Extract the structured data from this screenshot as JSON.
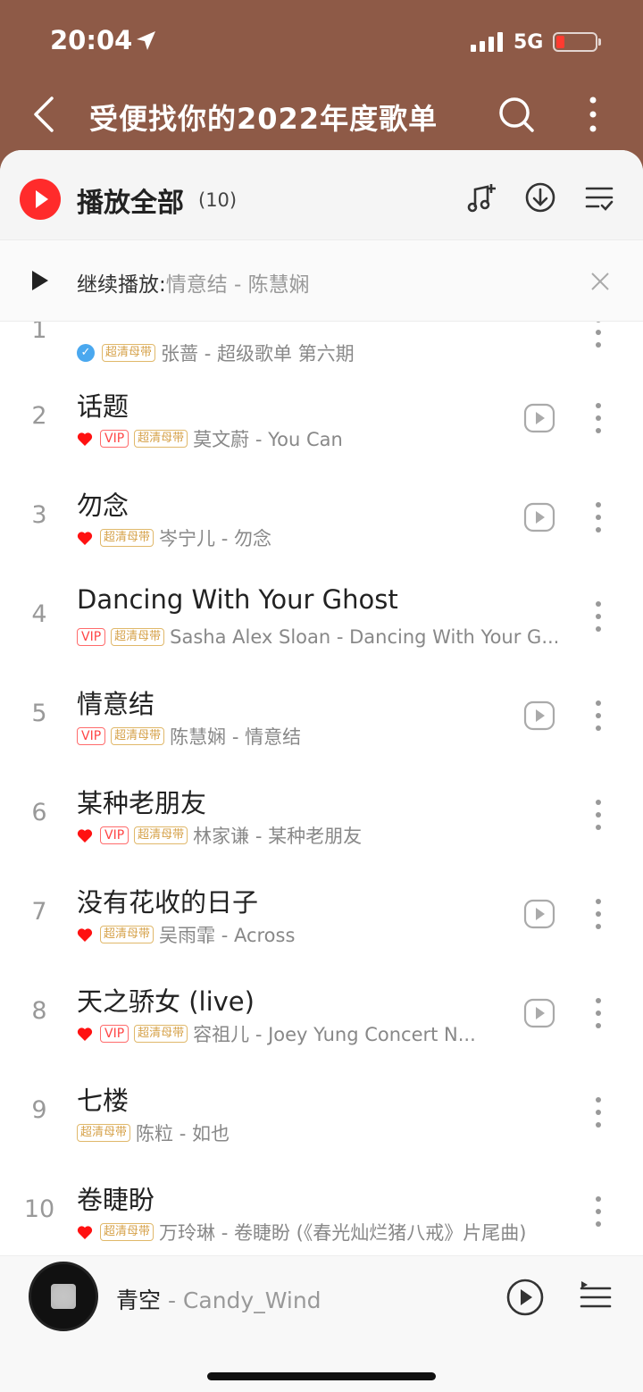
{
  "status": {
    "time": "20:04",
    "network": "5G"
  },
  "nav": {
    "title": "受便找你的2022年度歌单"
  },
  "play_all": {
    "label": "播放全部",
    "count": "(10)"
  },
  "resume": {
    "prefix": "继续播放:",
    "song": "情意结 - 陈慧娴"
  },
  "songs": [
    {
      "num": "1",
      "title": "",
      "meta": "张蔷 - 超级歌单  第六期"
    },
    {
      "num": "2",
      "title": "话题",
      "meta": "莫文蔚 - You Can"
    },
    {
      "num": "3",
      "title": "勿念",
      "meta": "岑宁儿 - 勿念"
    },
    {
      "num": "4",
      "title": "Dancing With Your Ghost",
      "meta": "Sasha Alex Sloan - Dancing With Your G..."
    },
    {
      "num": "5",
      "title": "情意结",
      "meta": "陈慧娴 - 情意结"
    },
    {
      "num": "6",
      "title": "某种老朋友",
      "meta": "林家谦 - 某种老朋友"
    },
    {
      "num": "7",
      "title": "没有花收的日子",
      "meta": "吴雨霏 - Across"
    },
    {
      "num": "8",
      "title": "天之骄女 (live)",
      "meta": "容祖儿 - Joey Yung Concert N..."
    },
    {
      "num": "9",
      "title": "七楼",
      "meta": "陈粒 - 如也"
    },
    {
      "num": "10",
      "title": "卷睫盼",
      "meta": "万玲琳 - 卷睫盼 (《春光灿烂猪八戒》片尾曲)"
    }
  ],
  "badges": {
    "vip": "VIP",
    "sq": "超清母带"
  },
  "player": {
    "title": "青空",
    "artist": "- Candy_Wind"
  },
  "colors": {
    "header_bg": "#8e5a47",
    "accent_red": "#ff2b2b",
    "gold_badge": "#d6a24a"
  }
}
